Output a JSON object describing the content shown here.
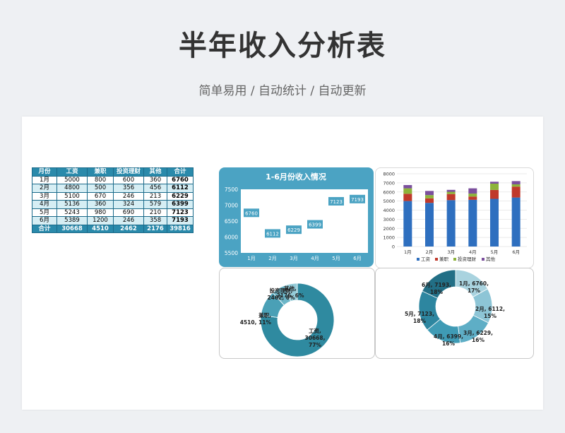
{
  "header": {
    "title": "半年收入分析表",
    "subtitle": "简单易用 / 自动统计 / 自动更新"
  },
  "table": {
    "columns": [
      "月份",
      "工资",
      "兼职",
      "投资理财",
      "其他",
      "合计"
    ],
    "rows": [
      [
        "1月",
        "5000",
        "800",
        "600",
        "360",
        "6760"
      ],
      [
        "2月",
        "4800",
        "500",
        "356",
        "456",
        "6112"
      ],
      [
        "3月",
        "5100",
        "670",
        "246",
        "213",
        "6229"
      ],
      [
        "4月",
        "5136",
        "360",
        "324",
        "579",
        "6399"
      ],
      [
        "5月",
        "5243",
        "980",
        "690",
        "210",
        "7123"
      ],
      [
        "6月",
        "5389",
        "1200",
        "246",
        "358",
        "7193"
      ]
    ],
    "total": [
      "合计",
      "30668",
      "4510",
      "2462",
      "2176",
      "39816"
    ]
  },
  "chart_data": [
    {
      "type": "line",
      "title": "1-6月份收入情况",
      "categories": [
        "1月",
        "2月",
        "3月",
        "4月",
        "5月",
        "6月"
      ],
      "values": [
        6760,
        6112,
        6229,
        6399,
        7123,
        7193
      ],
      "ylim": [
        5500,
        7500
      ],
      "yticks": [
        5500,
        6000,
        6500,
        7000,
        7500
      ],
      "grid": false,
      "colors": {
        "background": "#4ba3c3",
        "label_box": "#4ba3c3"
      }
    },
    {
      "type": "bar",
      "stacked": true,
      "categories": [
        "1月",
        "2月",
        "3月",
        "4月",
        "5月",
        "6月"
      ],
      "series": [
        {
          "name": "工资",
          "values": [
            5000,
            4800,
            5100,
            5136,
            5243,
            5389
          ],
          "color": "#2e6fbf"
        },
        {
          "name": "兼职",
          "values": [
            800,
            500,
            670,
            360,
            980,
            1200
          ],
          "color": "#c0392b"
        },
        {
          "name": "投资理财",
          "values": [
            600,
            356,
            246,
            324,
            690,
            246
          ],
          "color": "#8db33a"
        },
        {
          "name": "其他",
          "values": [
            360,
            456,
            213,
            579,
            210,
            358
          ],
          "color": "#7b4f9d"
        }
      ],
      "ylim": [
        0,
        8000
      ],
      "yticks": [
        0,
        1000,
        2000,
        3000,
        4000,
        5000,
        6000,
        7000,
        8000
      ],
      "legend": "bottom",
      "grid": true
    },
    {
      "type": "pie",
      "donut": true,
      "slices": [
        {
          "name": "工资",
          "value": 30668,
          "pct": "77%",
          "color": "#2f8aa0"
        },
        {
          "name": "兼职",
          "value": 4510,
          "pct": "11%",
          "color": "#4aa0b6"
        },
        {
          "name": "投资理财",
          "value": 2462,
          "pct": "6%",
          "color": "#6cb6c8"
        },
        {
          "name": "其他",
          "value": 2176,
          "pct": "6%",
          "color": "#94cbd8"
        }
      ],
      "labels": [
        [
          "工资,",
          "30668,",
          "77%"
        ],
        [
          "兼职,",
          "4510, 11%"
        ],
        [
          "投资理财,",
          "2462, 6%"
        ],
        [
          "其他,",
          "2176, 6%"
        ]
      ]
    },
    {
      "type": "pie",
      "donut": true,
      "slices": [
        {
          "name": "1月",
          "value": 6760,
          "pct": "17%",
          "color": "#a9d3df"
        },
        {
          "name": "2月",
          "value": 6112,
          "pct": "15%",
          "color": "#8dc5d6"
        },
        {
          "name": "3月",
          "value": 6229,
          "pct": "16%",
          "color": "#5eaec6"
        },
        {
          "name": "4月",
          "value": 6399,
          "pct": "16%",
          "color": "#3f9bb5"
        },
        {
          "name": "5月",
          "value": 7123,
          "pct": "18%",
          "color": "#2d86a0"
        },
        {
          "name": "6月",
          "value": 7193,
          "pct": "18%",
          "color": "#226f86"
        }
      ],
      "labels": [
        [
          "1月, 6760,",
          "17%"
        ],
        [
          "2月, 6112,",
          "15%"
        ],
        [
          "3月, 6229,",
          "16%"
        ],
        [
          "4月, 6399,",
          "16%"
        ],
        [
          "5月, 7123,",
          "18%"
        ],
        [
          "6月, 7193,",
          "18%"
        ]
      ]
    }
  ]
}
